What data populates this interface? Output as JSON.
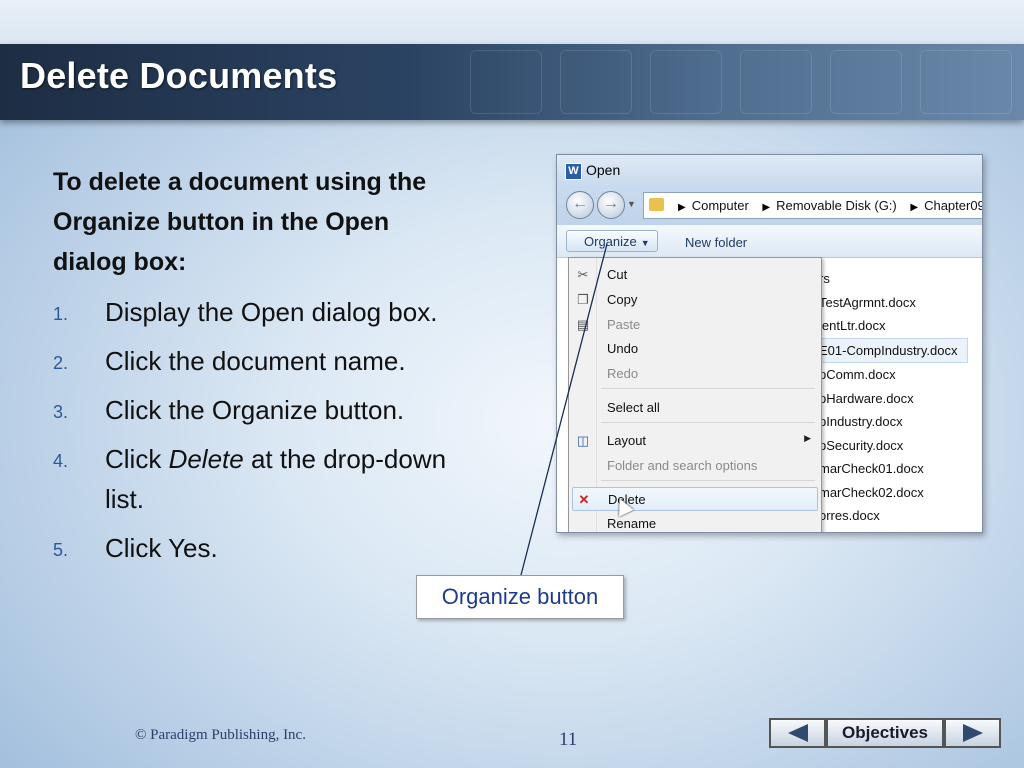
{
  "slide": {
    "title": "Delete Documents",
    "intro": "To delete a document using the Organize button in the Open dialog box:",
    "steps": [
      {
        "num": "1.",
        "pre": "Display the Open dialog box.",
        "em": "",
        "post": ""
      },
      {
        "num": "2.",
        "pre": "Click the document name.",
        "em": "",
        "post": ""
      },
      {
        "num": "3.",
        "pre": "Click the Organize button.",
        "em": "",
        "post": ""
      },
      {
        "num": "4.",
        "pre": "Click ",
        "em": "Delete",
        "post": " at the drop-down list."
      },
      {
        "num": "5.",
        "pre": "Click Yes.",
        "em": "",
        "post": ""
      }
    ],
    "callout": "Organize button",
    "copyright": "© Paradigm Publishing, Inc.",
    "page_number": "11",
    "nav": {
      "objectives_label": "Objectives"
    }
  },
  "dialog": {
    "title_icon": "W",
    "title": "Open",
    "breadcrumbs": [
      "Computer",
      "Removable Disk (G:)",
      "Chapter09"
    ],
    "organize_label": "Organize",
    "new_folder_label": "New folder",
    "files": [
      "rs",
      "TestAgrmnt.docx",
      "ientLtr.docx",
      "E01-CompIndustry.docx",
      "pComm.docx",
      "pHardware.docx",
      "pIndustry.docx",
      "pSecurity.docx",
      "marCheck01.docx",
      "marCheck02.docx",
      "orres.docx"
    ],
    "menu": {
      "cut": "Cut",
      "copy": "Copy",
      "paste": "Paste",
      "undo": "Undo",
      "redo": "Redo",
      "select_all": "Select all",
      "layout": "Layout",
      "folder_options": "Folder and search options",
      "delete": "Delete",
      "rename": "Rename"
    }
  },
  "colors": {
    "title_bar": "#2b4363",
    "callout_text": "#1f3c8c",
    "step_number": "#2a5a9a"
  }
}
